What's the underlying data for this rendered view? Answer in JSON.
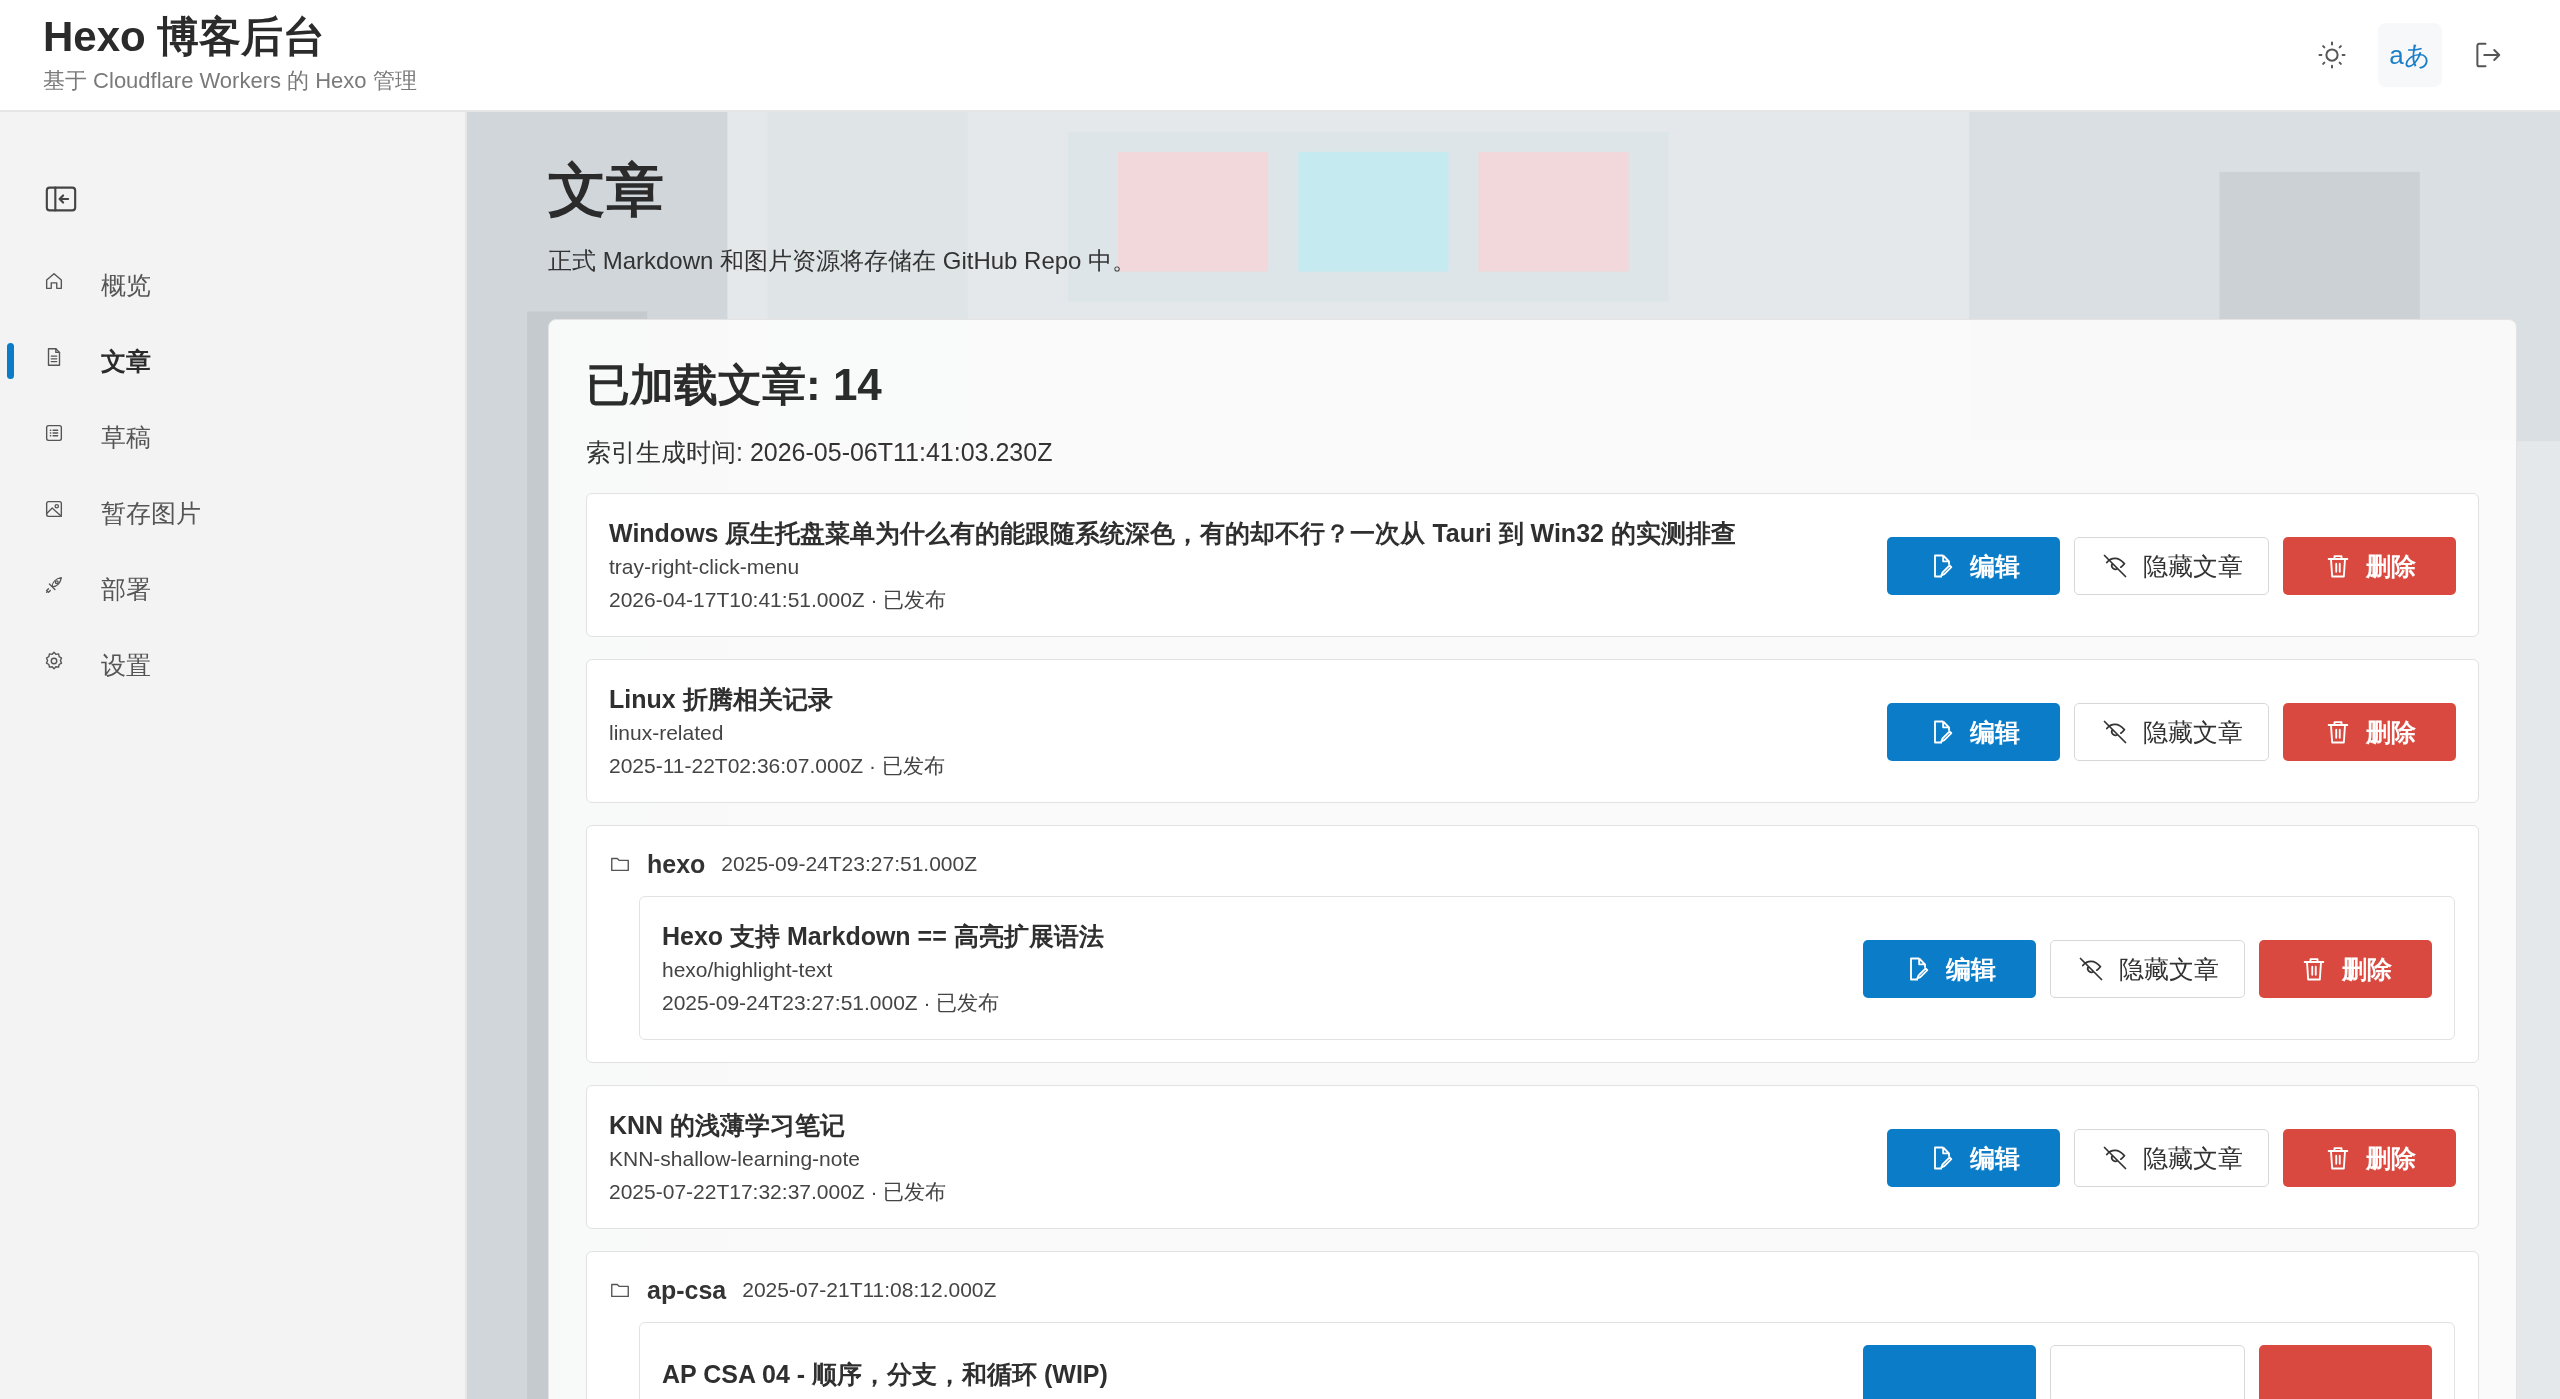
{
  "header": {
    "title": "Hexo 博客后台",
    "subtitle": "基于 Cloudflare Workers 的 Hexo 管理",
    "tools": [
      {
        "selected": false
      },
      {
        "glyph": "aあ",
        "selected": true
      },
      {
        "selected": false
      }
    ]
  },
  "sidebar": {
    "items": [
      {
        "label": "概览",
        "selected": false
      },
      {
        "label": "文章",
        "selected": true
      },
      {
        "label": "草稿",
        "selected": false
      },
      {
        "label": "暂存图片",
        "selected": false
      },
      {
        "label": "部署",
        "selected": false
      },
      {
        "label": "设置",
        "selected": false
      }
    ]
  },
  "page": {
    "title": "文章",
    "description": "正式 Markdown 和图片资源将存储在 GitHub Repo 中。"
  },
  "posts_panel": {
    "heading": "已加载文章: 14",
    "index_time": "索引生成时间: 2026-05-06T11:41:03.230Z",
    "entries": [
      {
        "kind": "post",
        "title": "Windows 原生托盘菜单为什么有的能跟随系统深色，有的却不行？一次从 Tauri 到 Win32 的实测排查",
        "slug": "tray-right-click-menu",
        "meta": "2026-04-17T10:41:51.000Z · 已发布",
        "actions": [
          {
            "kind": "edit",
            "label": "编辑"
          },
          {
            "kind": "hide",
            "label": "隐藏文章"
          },
          {
            "kind": "delete",
            "label": "删除"
          }
        ]
      },
      {
        "kind": "post",
        "title": "Linux 折腾相关记录",
        "slug": "linux-related",
        "meta": "2025-11-22T02:36:07.000Z · 已发布",
        "actions": [
          {
            "kind": "edit",
            "label": "编辑"
          },
          {
            "kind": "hide",
            "label": "隐藏文章"
          },
          {
            "kind": "delete",
            "label": "删除"
          }
        ]
      },
      {
        "kind": "folder",
        "name": "hexo",
        "date": "2025-09-24T23:27:51.000Z",
        "children": [
          {
            "title": "Hexo 支持 Markdown == 高亮扩展语法",
            "slug": "hexo/highlight-text",
            "meta": "2025-09-24T23:27:51.000Z · 已发布",
            "actions": [
              {
                "kind": "edit",
                "label": "编辑"
              },
              {
                "kind": "hide",
                "label": "隐藏文章"
              },
              {
                "kind": "delete",
                "label": "删除"
              }
            ]
          }
        ]
      },
      {
        "kind": "post",
        "title": "KNN 的浅薄学习笔记",
        "slug": "KNN-shallow-learning-note",
        "meta": "2025-07-22T17:32:37.000Z · 已发布",
        "actions": [
          {
            "kind": "edit",
            "label": "编辑"
          },
          {
            "kind": "hide",
            "label": "隐藏文章"
          },
          {
            "kind": "delete",
            "label": "删除"
          }
        ]
      },
      {
        "kind": "folder",
        "name": "ap-csa",
        "date": "2025-07-21T11:08:12.000Z",
        "children": [
          {
            "title": "AP CSA 04 - 顺序，分支，和循环 (WIP)",
            "actions": [
              {
                "kind": "edit"
              },
              {
                "kind": "hide"
              },
              {
                "kind": "delete"
              }
            ]
          }
        ]
      }
    ]
  }
}
